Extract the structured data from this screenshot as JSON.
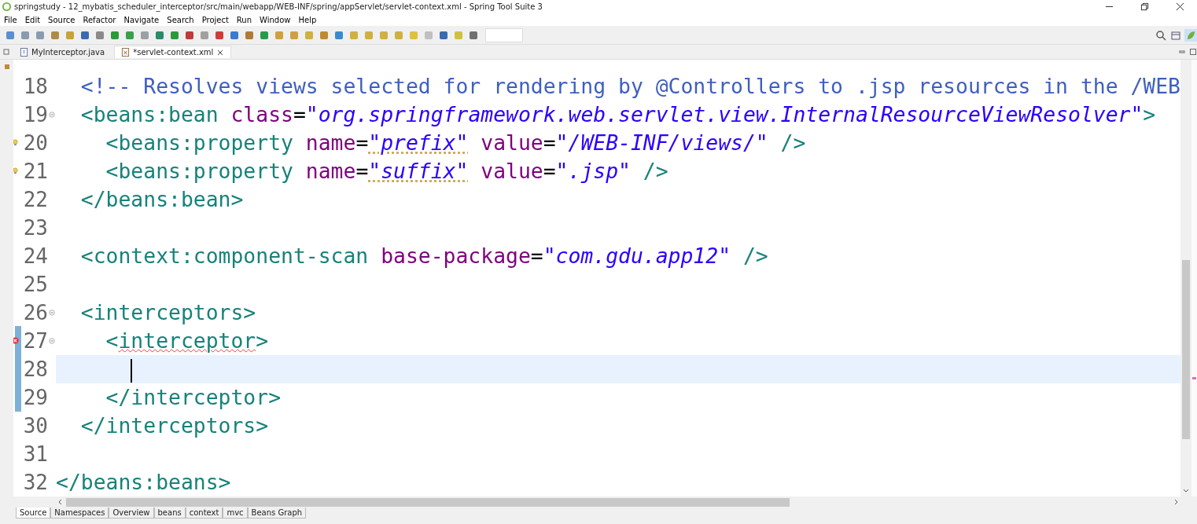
{
  "window": {
    "title": "springstudy - 12_mybatis_scheduler_interceptor/src/main/webapp/WEB-INF/spring/appServlet/servlet-context.xml - Spring Tool Suite 3"
  },
  "menu": [
    "File",
    "Edit",
    "Source",
    "Refactor",
    "Navigate",
    "Search",
    "Project",
    "Run",
    "Window",
    "Help"
  ],
  "tabs": [
    {
      "label": "MyInterceptor.java",
      "kind": "java",
      "selected": false
    },
    {
      "label": "*servlet-context.xml",
      "kind": "xml",
      "selected": true
    }
  ],
  "editor": {
    "lines": [
      {
        "number": "18",
        "warning": false,
        "error": false,
        "changed": false,
        "foldable": false,
        "current": false,
        "tokens": [
          {
            "kind": "comment",
            "text": "  <!-- Resolves views selected for rendering by @Controllers to .jsp resources in the /WEB"
          }
        ]
      },
      {
        "number": "19",
        "warning": false,
        "error": false,
        "changed": false,
        "foldable": true,
        "current": false,
        "tokens": [
          {
            "kind": "tag",
            "text": "  <beans:bean"
          },
          {
            "kind": "attr",
            "text": " class"
          },
          {
            "kind": "eq",
            "text": "="
          },
          {
            "kind": "str",
            "text": "\"org.springframework.web.servlet.view.InternalResourceViewResolver\""
          },
          {
            "kind": "tag",
            "text": ">"
          }
        ]
      },
      {
        "number": "20",
        "warning": true,
        "error": false,
        "changed": false,
        "foldable": false,
        "current": false,
        "tokens": [
          {
            "kind": "tag",
            "text": "    <beans:property"
          },
          {
            "kind": "attr",
            "text": " name"
          },
          {
            "kind": "eq",
            "text": "="
          },
          {
            "kind": "str",
            "text": "\"prefix\"",
            "warning": true
          },
          {
            "kind": "attr",
            "text": " value"
          },
          {
            "kind": "eq",
            "text": "="
          },
          {
            "kind": "str",
            "text": "\"/WEB-INF/views/\""
          },
          {
            "kind": "tag",
            "text": " />"
          }
        ]
      },
      {
        "number": "21",
        "warning": true,
        "error": false,
        "changed": false,
        "foldable": false,
        "current": false,
        "tokens": [
          {
            "kind": "tag",
            "text": "    <beans:property"
          },
          {
            "kind": "attr",
            "text": " name"
          },
          {
            "kind": "eq",
            "text": "="
          },
          {
            "kind": "str",
            "text": "\"suffix\"",
            "warning": true
          },
          {
            "kind": "attr",
            "text": " value"
          },
          {
            "kind": "eq",
            "text": "="
          },
          {
            "kind": "str",
            "text": "\".jsp\""
          },
          {
            "kind": "tag",
            "text": " />"
          }
        ]
      },
      {
        "number": "22",
        "warning": false,
        "error": false,
        "changed": false,
        "foldable": false,
        "current": false,
        "tokens": [
          {
            "kind": "tag",
            "text": "  </beans:bean>"
          }
        ]
      },
      {
        "number": "23",
        "warning": false,
        "error": false,
        "changed": false,
        "foldable": false,
        "current": false
      },
      {
        "number": "24",
        "warning": false,
        "error": false,
        "changed": false,
        "foldable": false,
        "current": false,
        "tokens": [
          {
            "kind": "tag",
            "text": "  <context:component-scan"
          },
          {
            "kind": "attr",
            "text": " base-package"
          },
          {
            "kind": "eq",
            "text": "="
          },
          {
            "kind": "str",
            "text": "\"com.gdu.app12\""
          },
          {
            "kind": "tag",
            "text": " />"
          }
        ]
      },
      {
        "number": "25",
        "warning": false,
        "error": false,
        "changed": false,
        "foldable": false,
        "current": false
      },
      {
        "number": "26",
        "warning": false,
        "error": false,
        "changed": false,
        "foldable": true,
        "current": false,
        "tokens": [
          {
            "kind": "tag",
            "text": "  <interceptors>"
          }
        ]
      },
      {
        "number": "27",
        "warning": false,
        "error": true,
        "changed": true,
        "foldable": true,
        "current": false,
        "tokens": [
          {
            "kind": "tag",
            "text": "    <"
          },
          {
            "kind": "tag",
            "text": "interceptor",
            "error": true
          },
          {
            "kind": "tag",
            "text": ">"
          }
        ]
      },
      {
        "number": "28",
        "warning": false,
        "error": false,
        "changed": true,
        "foldable": false,
        "current": true,
        "tokens": [
          {
            "kind": "cursor"
          }
        ]
      },
      {
        "number": "29",
        "warning": false,
        "error": false,
        "changed": true,
        "foldable": false,
        "current": false,
        "tokens": [
          {
            "kind": "tag",
            "text": "    </interceptor>"
          }
        ]
      },
      {
        "number": "30",
        "warning": false,
        "error": false,
        "changed": false,
        "foldable": false,
        "current": false,
        "tokens": [
          {
            "kind": "tag",
            "text": "  </interceptors>"
          }
        ]
      },
      {
        "number": "31",
        "warning": false,
        "error": false,
        "changed": false,
        "foldable": false,
        "current": false
      },
      {
        "number": "32",
        "warning": false,
        "error": false,
        "changed": false,
        "foldable": false,
        "current": false,
        "tokens": [
          {
            "kind": "tag",
            "text": "</beans:beans>"
          }
        ]
      }
    ]
  },
  "bottom_tabs": [
    {
      "label": "Source",
      "selected": true
    },
    {
      "label": "Namespaces",
      "selected": false
    },
    {
      "label": "Overview",
      "selected": false
    },
    {
      "label": "beans",
      "selected": false
    },
    {
      "label": "context",
      "selected": false
    },
    {
      "label": "mvc",
      "selected": false
    },
    {
      "label": "Beans Graph",
      "selected": false
    }
  ]
}
